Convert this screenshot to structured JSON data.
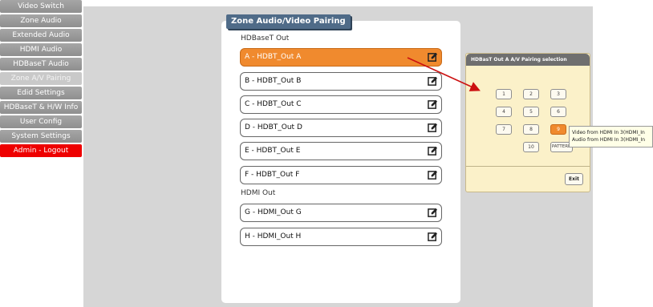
{
  "sidebar": {
    "items": [
      {
        "label": "Video Switch"
      },
      {
        "label": "Zone Audio"
      },
      {
        "label": "Extended Audio"
      },
      {
        "label": "HDMI Audio"
      },
      {
        "label": "HDBaseT Audio"
      },
      {
        "label": "Zone A/V Pairing"
      },
      {
        "label": "Edid Settings"
      },
      {
        "label": "HDBaseT & H/W Info"
      },
      {
        "label": "User Config"
      },
      {
        "label": "System Settings"
      },
      {
        "label": "Admin - Logout"
      }
    ]
  },
  "panel": {
    "title": "Zone Audio/Video Pairing",
    "hdbaset_label": "HDBaseT Out",
    "hdmi_label": "HDMI Out",
    "hdbaset_zones": [
      {
        "label": "A - HDBT_Out A"
      },
      {
        "label": "B - HDBT_Out B"
      },
      {
        "label": "C - HDBT_Out C"
      },
      {
        "label": "D - HDBT_Out D"
      },
      {
        "label": "E - HDBT_Out E"
      },
      {
        "label": "F - HDBT_Out F"
      }
    ],
    "hdmi_zones": [
      {
        "label": "G - HDMI_Out G"
      },
      {
        "label": "H - HDMI_Out H"
      }
    ]
  },
  "popup": {
    "title": "HDBasT Out A A/V Pairing selection",
    "sources": [
      "1",
      "2",
      "3",
      "4",
      "5",
      "6",
      "7",
      "8",
      "9",
      "10",
      "PATTERN"
    ],
    "selected": "9",
    "exit_label": "Exit"
  },
  "tooltip": {
    "line1": "Video from HDMI In 3(HDMI_In",
    "line2": "Audio from HDMI In 3(HDMI_In"
  },
  "colors": {
    "accent": "#f08a2e",
    "sidebar_bg": "#999999",
    "logout": "#ee0000",
    "title_bar": "#4f6b88",
    "arrow": "#cc1111"
  },
  "icons": {
    "zone_edit": "edit-pencil-icon",
    "pointer": "red-arrow"
  }
}
